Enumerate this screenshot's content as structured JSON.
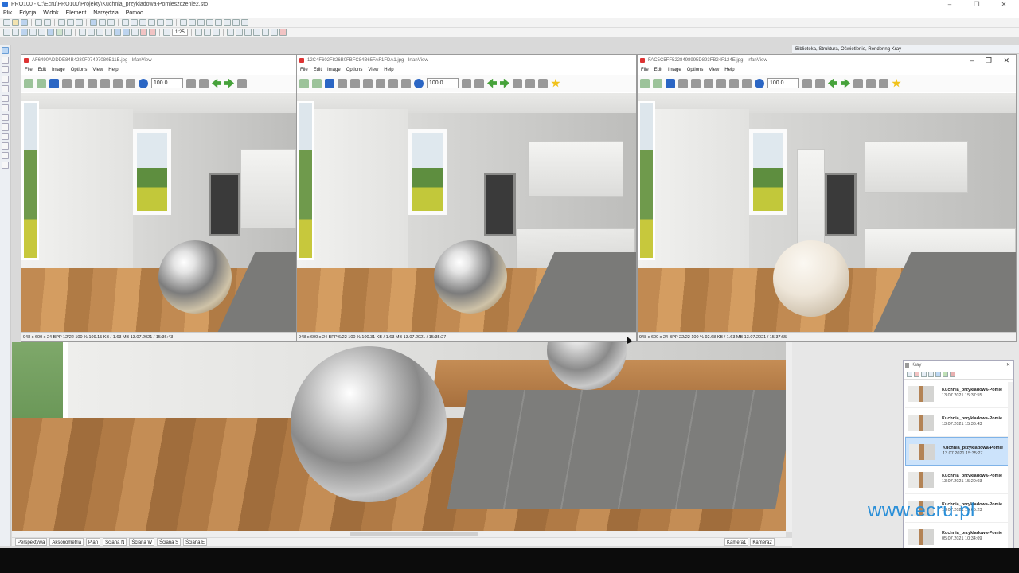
{
  "main": {
    "title": "PRO100 - C:\\Ecru\\PRO100\\Projekty\\Kuchnia_przykladowa-Pomieszczenie2.sto",
    "menu": [
      "Plik",
      "Edycja",
      "Widok",
      "Element",
      "Narzędzia",
      "Pomoc"
    ],
    "zoom": "1:25",
    "right_panel_tabs": "Biblioteka, Struktura, Oświetlenie, Rendering Kray",
    "view_tabs": [
      "Perspektywa",
      "Aksonometria",
      "Plan",
      "Ściana N",
      "Ściana W",
      "Ściana S",
      "Ściana E"
    ],
    "camera_tabs": [
      "Kamera1",
      "Kamera2"
    ],
    "win_min": "–",
    "win_max": "❐",
    "win_close": "✕"
  },
  "irfan": [
    {
      "title": "AF6490ADDDE84B4280F07497080E11B.jpg - IrfanView",
      "menu": [
        "File",
        "Edit",
        "Image",
        "Options",
        "View",
        "Help"
      ],
      "zoom": "100.0",
      "status": "948 x 600 x 24 BPP   12/22   100 %   109.15 KB / 1.63 MB   13.07.2021 / 15:36:43"
    },
    {
      "title": "12C4F602F826B0FBFC84B65FAF1FDA1.jpg - IrfanView",
      "menu": [
        "File",
        "Edit",
        "Image",
        "Options",
        "View",
        "Help"
      ],
      "zoom": "100.0",
      "status": "948 x 600 x 24 BPP   6/22   100 %   100.31 KB / 1.63 MB   13.07.2021 / 15:35:27"
    },
    {
      "title": "FAC5C5FF5228498995D893FB24F124E.jpg - IrfanView",
      "menu": [
        "File",
        "Edit",
        "Image",
        "Options",
        "View",
        "Help"
      ],
      "zoom": "100.0",
      "status": "948 x 600 x 24 BPP   22/22   100 %   92.68 KB / 1.63 MB   13.07.2021 / 15:37:55"
    }
  ],
  "kray": {
    "title": "Kray",
    "items": [
      {
        "name": "Kuchnia_przykladowa-Pomie",
        "date": "13.07.2021 15:37:55"
      },
      {
        "name": "Kuchnia_przykladowa-Pomie",
        "date": "13.07.2021 15:36:43"
      },
      {
        "name": "Kuchnia_przykladowa-Pomie",
        "date": "13.07.2021 15:35:27"
      },
      {
        "name": "Kuchnia_przykladowa-Pomie",
        "date": "13.07.2021 15:20:03"
      },
      {
        "name": "Kuchnia_przykladowa-Pomie",
        "date": "13.07.2021 15:05:23"
      },
      {
        "name": "Kuchnia_przykladowa-Pomie",
        "date": "05.07.2021 10:34:09"
      }
    ]
  },
  "watermark": "www.ecru.pl"
}
